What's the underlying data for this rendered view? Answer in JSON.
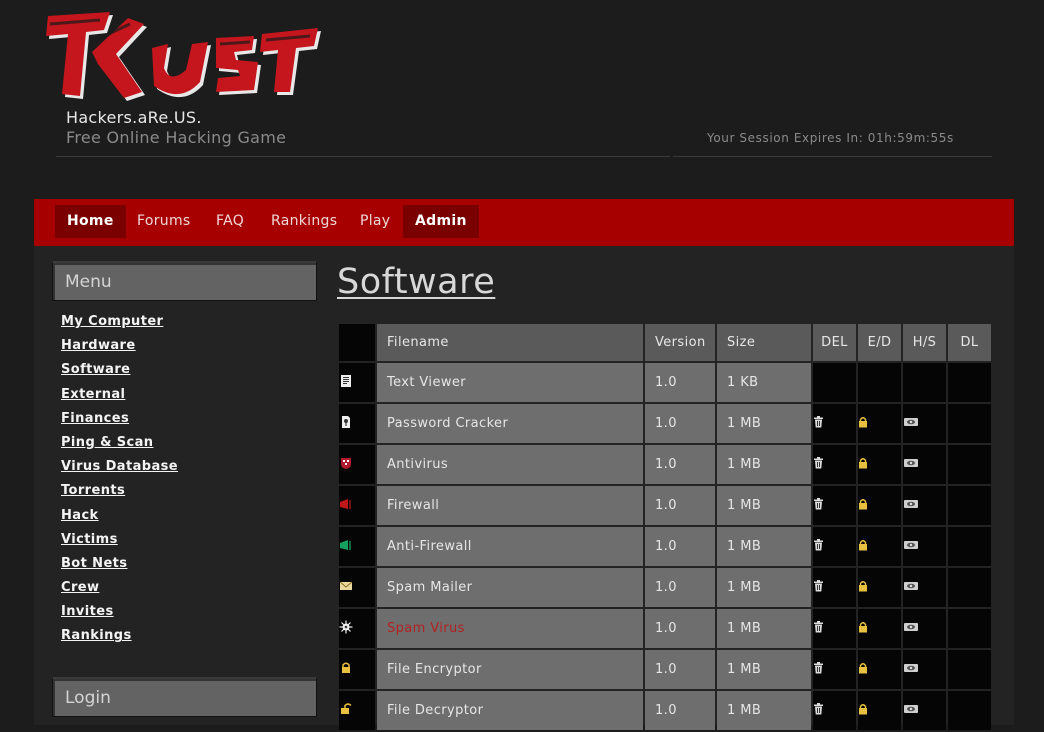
{
  "header": {
    "logo_text": "KRUS",
    "site_name": "Hackers.aRe.US.",
    "tagline": "Free Online Hacking Game",
    "session_text": "Your Session Expires In: 01h:59m:55s"
  },
  "nav": {
    "items": [
      {
        "label": "Home",
        "active": true
      },
      {
        "label": "Forums",
        "active": false
      },
      {
        "label": "FAQ",
        "active": false
      },
      {
        "label": "Rankings",
        "active": false
      },
      {
        "label": "Play",
        "active": false
      },
      {
        "label": "Admin",
        "active": true
      }
    ]
  },
  "sidebar": {
    "menu_title": "Menu",
    "items": [
      "My Computer",
      "Hardware",
      "Software",
      "External",
      "Finances",
      "Ping & Scan",
      "Virus Database",
      "Torrents",
      "Hack",
      "Victims",
      "Bot Nets",
      "Crew",
      "Invites",
      "Rankings"
    ],
    "login_title": "Login"
  },
  "software": {
    "title": "Software",
    "columns": {
      "filename": "Filename",
      "version": "Version",
      "size": "Size",
      "del": "DEL",
      "ed": "E/D",
      "hs": "H/S",
      "dl": "DL"
    },
    "rows": [
      {
        "icon": "text-viewer-icon",
        "name": "Text Viewer",
        "version": "1.0",
        "size": "1 KB",
        "actions": false,
        "highlight": false
      },
      {
        "icon": "password-cracker-icon",
        "name": "Password Cracker",
        "version": "1.0",
        "size": "1 MB",
        "actions": true,
        "highlight": false
      },
      {
        "icon": "antivirus-icon",
        "name": "Antivirus",
        "version": "1.0",
        "size": "1 MB",
        "actions": true,
        "highlight": false
      },
      {
        "icon": "firewall-icon",
        "name": "Firewall",
        "version": "1.0",
        "size": "1 MB",
        "actions": true,
        "highlight": false
      },
      {
        "icon": "anti-firewall-icon",
        "name": "Anti-Firewall",
        "version": "1.0",
        "size": "1 MB",
        "actions": true,
        "highlight": false
      },
      {
        "icon": "envelope-icon",
        "name": "Spam Mailer",
        "version": "1.0",
        "size": "1 MB",
        "actions": true,
        "highlight": false
      },
      {
        "icon": "virus-icon",
        "name": "Spam Virus",
        "version": "1.0",
        "size": "1 MB",
        "actions": true,
        "highlight": true
      },
      {
        "icon": "lock-icon",
        "name": "File Encryptor",
        "version": "1.0",
        "size": "1 MB",
        "actions": true,
        "highlight": false
      },
      {
        "icon": "unlock-icon",
        "name": "File Decryptor",
        "version": "1.0",
        "size": "1 MB",
        "actions": true,
        "highlight": false
      }
    ]
  },
  "colors": {
    "nav_bg": "#a60000",
    "nav_active": "#7a0000",
    "highlight_text": "#b22222"
  }
}
